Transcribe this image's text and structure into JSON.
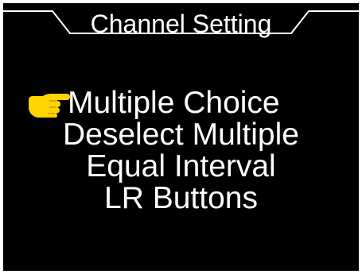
{
  "header": {
    "title": "Channel Setting"
  },
  "menu": {
    "items": [
      {
        "label": "Multiple Choice",
        "selected": true
      },
      {
        "label": "Deselect Multiple",
        "selected": false
      },
      {
        "label": "Equal Interval",
        "selected": false
      },
      {
        "label": "LR Buttons",
        "selected": false
      }
    ]
  },
  "colors": {
    "background": "#000000",
    "text": "#ffffff",
    "pointer": "#ffd400",
    "frame": "#ffffff"
  },
  "icons": {
    "pointer": "pointing-hand-icon"
  }
}
